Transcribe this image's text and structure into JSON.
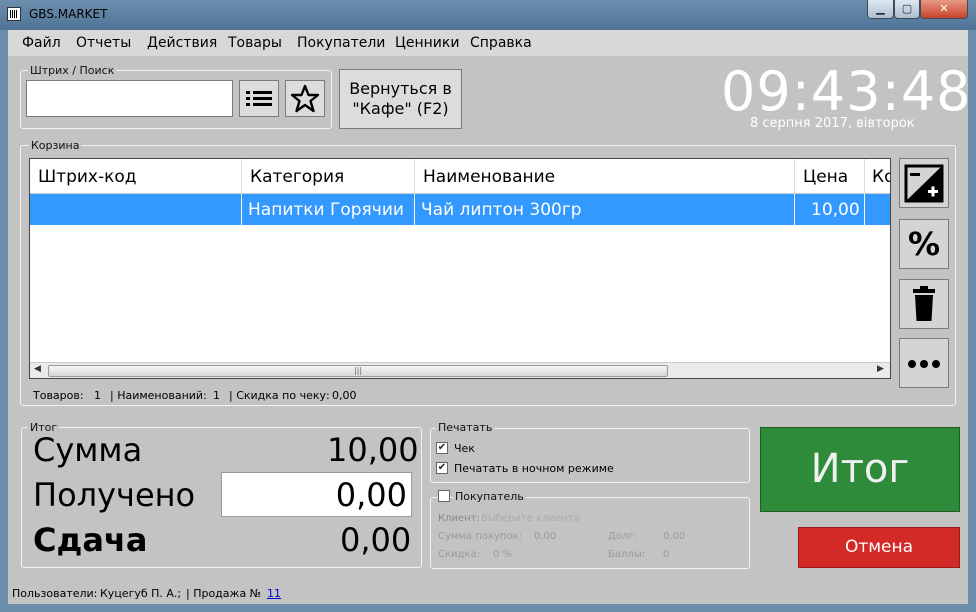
{
  "window": {
    "title": "GBS.MARKET",
    "min": "▁",
    "max": "▢",
    "close": "✕"
  },
  "menu": [
    "Файл",
    "Отчеты",
    "Действия",
    "Товары",
    "Покупатели",
    "Ценники",
    "Справка"
  ],
  "search": {
    "label": "Штрих / Поиск",
    "value": ""
  },
  "back_button": {
    "line1": "Вернуться в",
    "line2": "\"Кафе\" (F2)"
  },
  "clock": {
    "time": "09:43:48",
    "date": "8 серпня 2017, вівторок"
  },
  "cart": {
    "label": "Корзина",
    "columns": [
      "Штрих-код",
      "Категория",
      "Наименование",
      "Цена",
      "Ко"
    ],
    "rows": [
      {
        "barcode": "",
        "category": "Напитки Горячии",
        "name": "Чай липтон 300гр",
        "price": "10,00"
      }
    ],
    "summary": {
      "items_label": "Товаров:",
      "items": "1",
      "names_label": "| Наименований:",
      "names": "1",
      "discount_label": "| Скидка по чеку:",
      "discount": "0,00"
    }
  },
  "totals": {
    "label": "Итог",
    "sum_label": "Сумма",
    "sum": "10,00",
    "received_label": "Получено",
    "received": "0,00",
    "change_label": "Сдача",
    "change": "0,00"
  },
  "print": {
    "label": "Печатать",
    "receipt": "Чек",
    "receipt_checked": true,
    "night": "Печатать в ночном режиме",
    "night_checked": true
  },
  "customer": {
    "label": "Покупатель",
    "checked": false,
    "client_label": "Клиент:",
    "client_placeholder": "Выберите клиента",
    "purchases_label": "Сумма покупок:",
    "purchases": "0,00",
    "debt_label": "Долг:",
    "debt": "0,00",
    "discount_label": "Скидка:",
    "discount": "0 %",
    "points_label": "Баллы:",
    "points": "0"
  },
  "actions": {
    "total": "Итог",
    "cancel": "Отмена",
    "total_color": "#2e8b3a",
    "cancel_color": "#d32a28"
  },
  "statusbar": {
    "users_label": "Пользователи:",
    "user": "Куцегуб П. А.;",
    "sale_label": "| Продажа №",
    "sale_number": "11"
  }
}
